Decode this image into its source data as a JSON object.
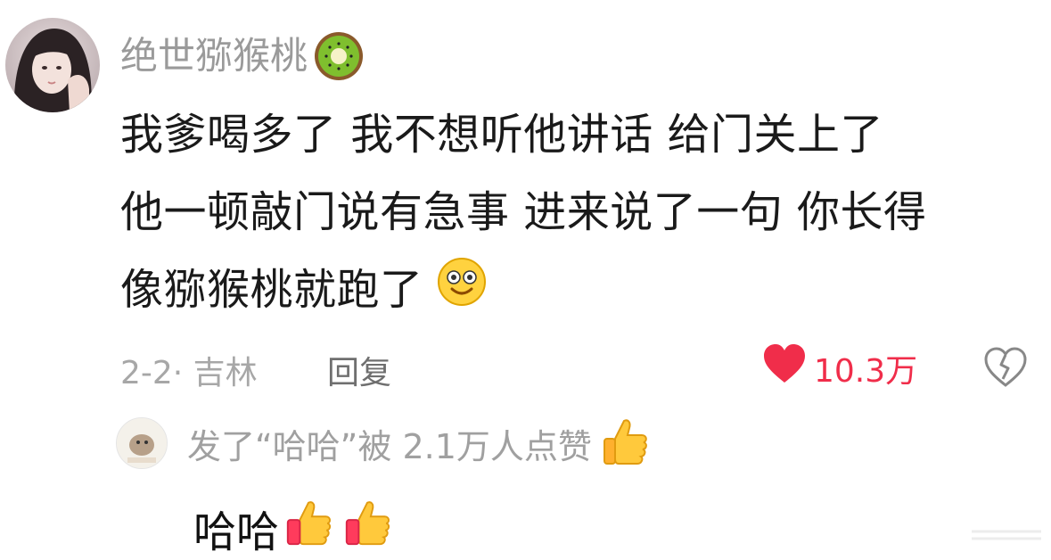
{
  "comment": {
    "username": "绝世猕猴桃",
    "lines": [
      "我爹喝多了 我不想听他讲话 给门关上了",
      "他一顿敲门说有急事 进来说了一句 你长得",
      "像猕猴桃就跑了"
    ],
    "date_location": "2-2· 吉林",
    "reply_label": "回复",
    "like_count": "10.3万"
  },
  "reply": {
    "badge_text": "发了“哈哈”被 2.1万人点赞",
    "content": "哈哈"
  },
  "icons": {
    "kiwi": "kiwi-emoji-icon",
    "smile": "smile-emoji-icon",
    "thumbs": "thumbs-up-emoji-icon",
    "like": "heart-icon",
    "dislike": "broken-heart-icon"
  },
  "colors": {
    "like_red": "#f02d4a",
    "muted_gray": "#9a9a9a",
    "text_dark": "#1a1a1a"
  }
}
